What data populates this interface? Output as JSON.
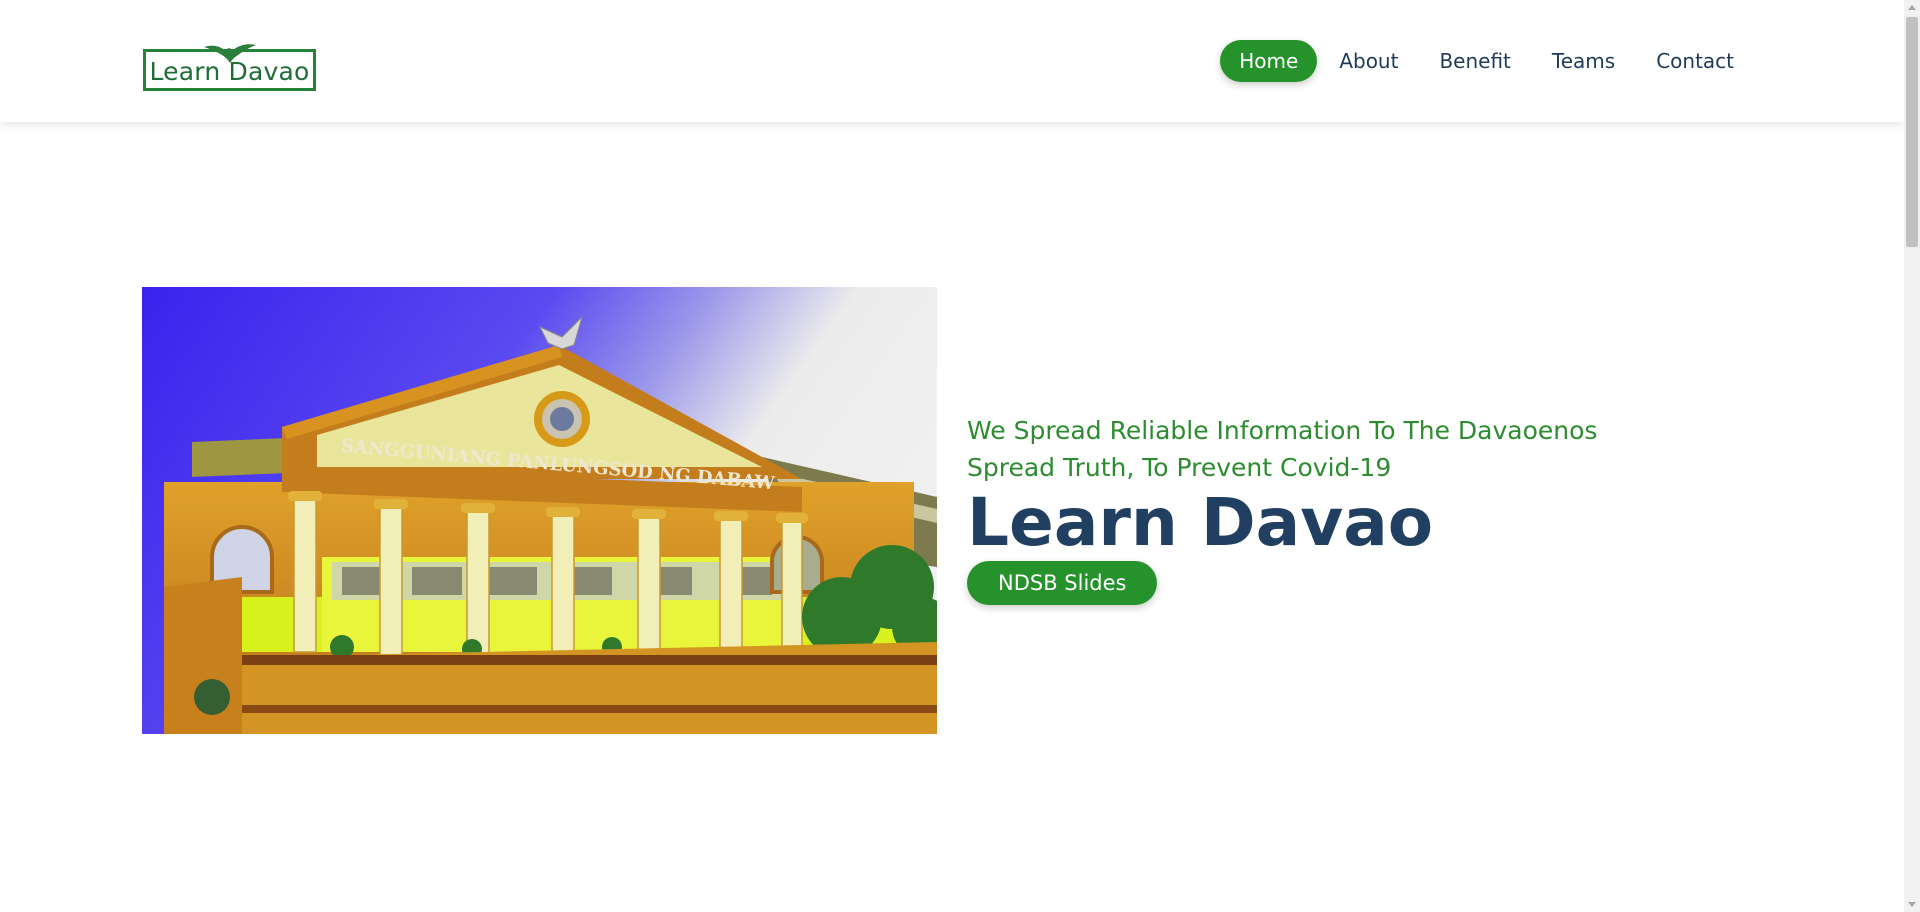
{
  "header": {
    "logo_text": "Learn Davao",
    "logo_icon": "eagle-icon",
    "nav": [
      {
        "label": "Home",
        "active": true
      },
      {
        "label": "About",
        "active": false
      },
      {
        "label": "Benefit",
        "active": false
      },
      {
        "label": "Teams",
        "active": false
      },
      {
        "label": "Contact",
        "active": false
      }
    ]
  },
  "hero": {
    "image_caption": "SANGGUNIANG PANLUNGSOD NG DABAW",
    "tagline_1": "We Spread Reliable Information To The Davaoenos",
    "tagline_2": "Spread Truth, To Prevent Covid-19",
    "title": "Learn Davao",
    "cta_label": "NDSB Slides"
  },
  "colors": {
    "brand_green": "#26922b",
    "title_navy": "#213f60",
    "tagline_green": "#2d8c2f"
  }
}
